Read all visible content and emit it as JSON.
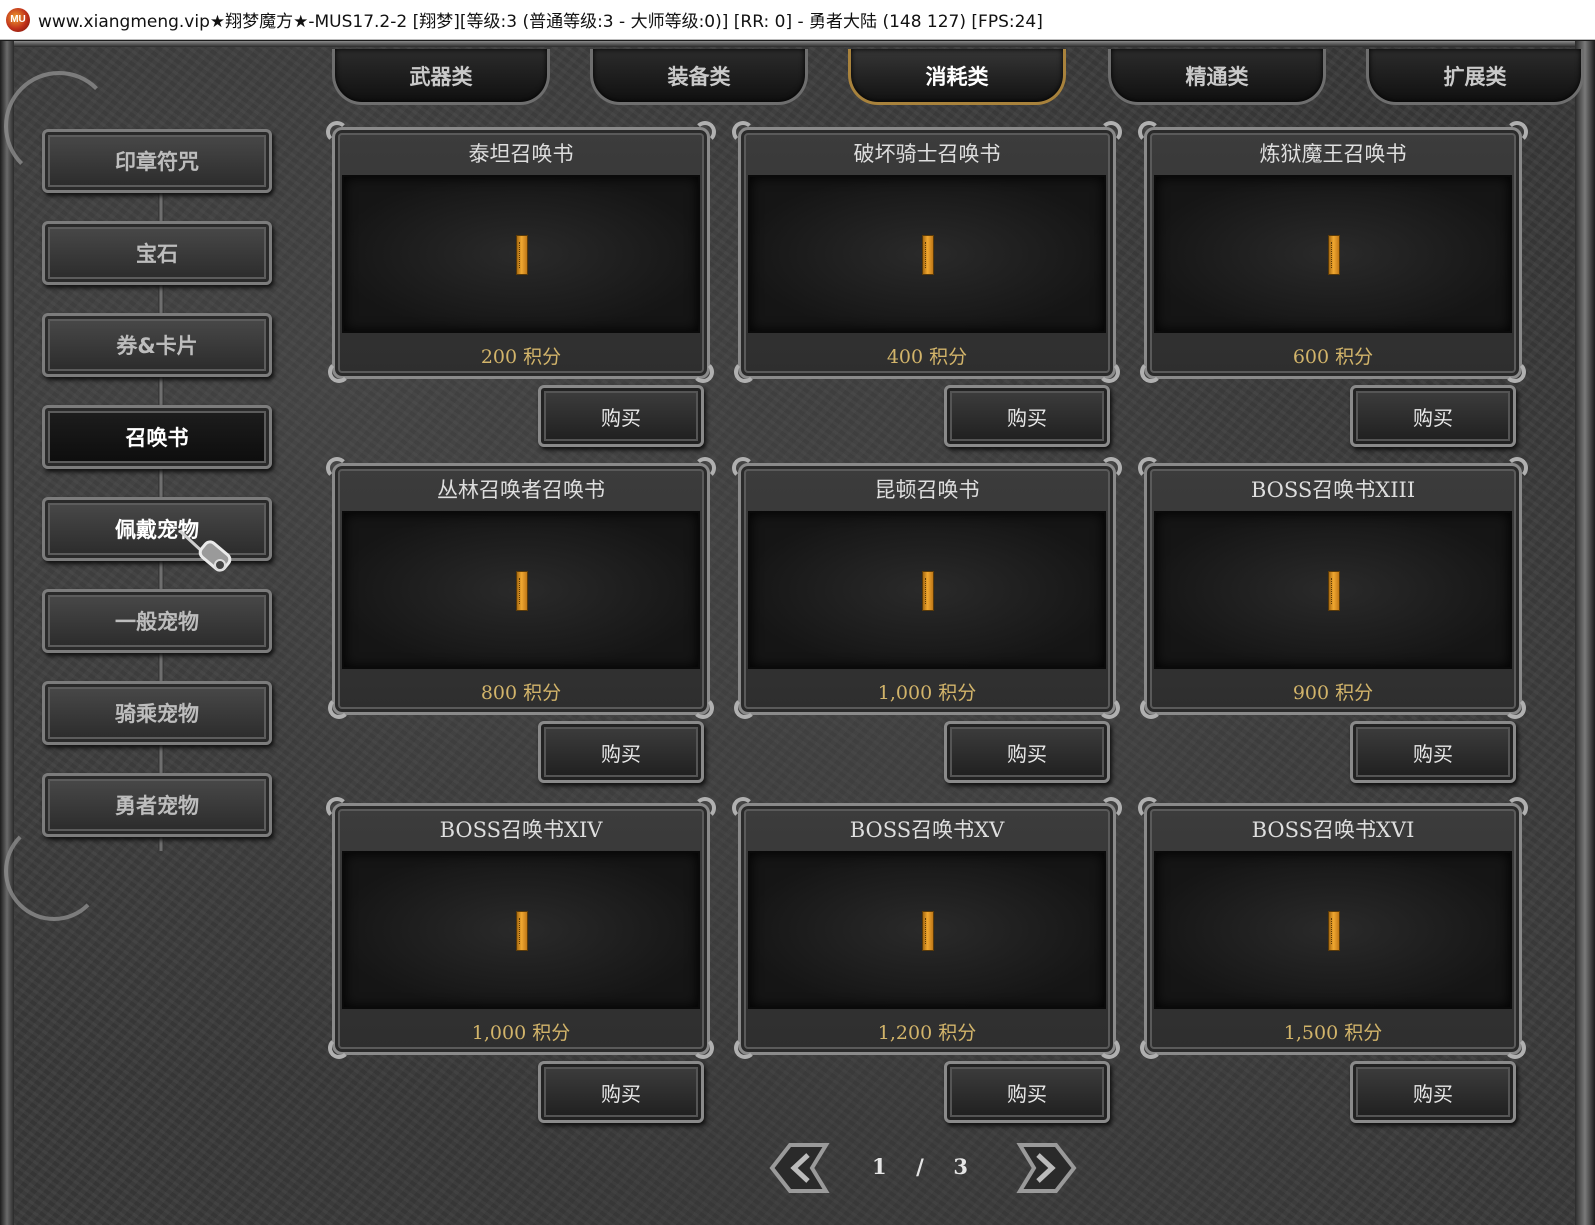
{
  "window": {
    "icon_label": "MU",
    "title": "www.xiangmeng.vip★翔梦魔方★-MUS17.2-2 [翔梦][等级:3 (普通等级:3 - 大师等级:0)] [RR: 0] - 勇者大陆 (148 127) [FPS:24]"
  },
  "tabs": [
    {
      "label": "武器类",
      "active": false
    },
    {
      "label": "装备类",
      "active": false
    },
    {
      "label": "消耗类",
      "active": true
    },
    {
      "label": "精通类",
      "active": false
    },
    {
      "label": "扩展类",
      "active": false
    }
  ],
  "categories": [
    {
      "label": "印章符咒",
      "active": false
    },
    {
      "label": "宝石",
      "active": false
    },
    {
      "label": "券&卡片",
      "active": false
    },
    {
      "label": "召唤书",
      "active": true
    },
    {
      "label": "佩戴宠物",
      "active": false
    },
    {
      "label": "一般宠物",
      "active": false
    },
    {
      "label": "骑乘宠物",
      "active": false
    },
    {
      "label": "勇者宠物",
      "active": false
    }
  ],
  "items": [
    {
      "name": "泰坦召唤书",
      "price": "200 积分",
      "buy_label": "购买"
    },
    {
      "name": "破坏骑士召唤书",
      "price": "400 积分",
      "buy_label": "购买"
    },
    {
      "name": "炼狱魔王召唤书",
      "price": "600 积分",
      "buy_label": "购买"
    },
    {
      "name": "丛林召唤者召唤书",
      "price": "800 积分",
      "buy_label": "购买"
    },
    {
      "name": "昆顿召唤书",
      "price": "1,000 积分",
      "buy_label": "购买"
    },
    {
      "name": "BOSS召唤书XIII",
      "price": "900 积分",
      "buy_label": "购买"
    },
    {
      "name": "BOSS召唤书XIV",
      "price": "1,000 积分",
      "buy_label": "购买"
    },
    {
      "name": "BOSS召唤书XV",
      "price": "1,200 积分",
      "buy_label": "购买"
    },
    {
      "name": "BOSS召唤书XVI",
      "price": "1,500 积分",
      "buy_label": "购买"
    }
  ],
  "pagination": {
    "current": "1",
    "separator": "/",
    "total": "3"
  },
  "icons": {
    "prev": "arrow-left-icon",
    "next": "arrow-right-icon",
    "cursor": "hammer-cursor-icon",
    "item": "scroll-icon"
  },
  "colors": {
    "active_tab_border": "#a8823c",
    "price_text": "#d2b46a",
    "scroll_gold": "#f0a830"
  }
}
